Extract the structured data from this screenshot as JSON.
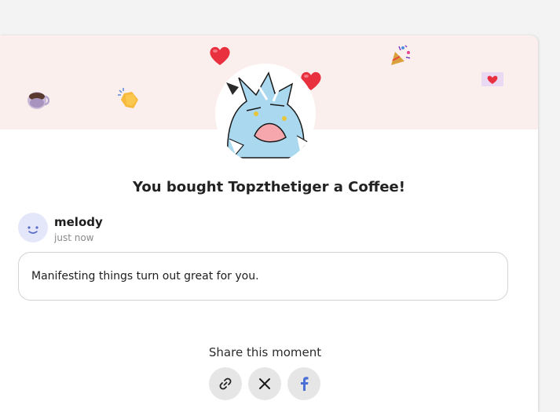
{
  "purchase": {
    "title": "You bought Topzthetiger a Coffee!"
  },
  "supporter": {
    "name": "melody",
    "time": "just now",
    "message": "Manifesting things turn out great for you."
  },
  "share": {
    "label": "Share this moment",
    "buttons": [
      "copy-link",
      "x",
      "facebook"
    ]
  },
  "decorations": [
    "coffee-icon",
    "clapping-hands-icon",
    "heart-icon",
    "heart-icon",
    "party-popper-icon",
    "love-letter-icon"
  ],
  "colors": {
    "banner": "#fbefed",
    "facebook": "#4a6fd6",
    "avatar_bg": "#e4e7f9"
  }
}
